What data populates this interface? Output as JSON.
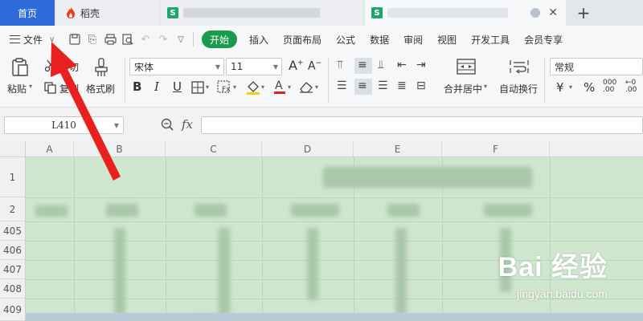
{
  "tabs": {
    "home": "首页",
    "daoke": "稻壳",
    "doc_icon": "S",
    "add": "+"
  },
  "menu": {
    "file": "文件",
    "items": [
      "开始",
      "插入",
      "页面布局",
      "公式",
      "数据",
      "审阅",
      "视图",
      "开发工具",
      "会员专享"
    ],
    "active_index": 0
  },
  "ribbon": {
    "paste": "粘贴",
    "cut": "剪切",
    "copy": "复制",
    "format_painter": "格式刷",
    "font_name": "宋体",
    "font_size": "11",
    "bold": "B",
    "italic": "I",
    "underline": "U",
    "merge_center": "合并居中",
    "wrap_text": "自动换行",
    "number_format": "常规",
    "currency": "¥",
    "percent": "%"
  },
  "formula_bar": {
    "name_box": "L410",
    "fx": "fx",
    "value": ""
  },
  "sheet": {
    "columns": [
      "A",
      "B",
      "C",
      "D",
      "E",
      "F"
    ],
    "rows": [
      "1",
      "2",
      "405",
      "406",
      "407",
      "408",
      "409"
    ]
  },
  "watermark": {
    "logo": "Bai 经验",
    "url": "jingyan.baidu.com"
  },
  "colors": {
    "accent_green": "#1a9b4b",
    "home_tab_blue": "#2f6bd8",
    "annotation_red": "#e8201e",
    "sheet_fill": "#cfe6cf"
  }
}
